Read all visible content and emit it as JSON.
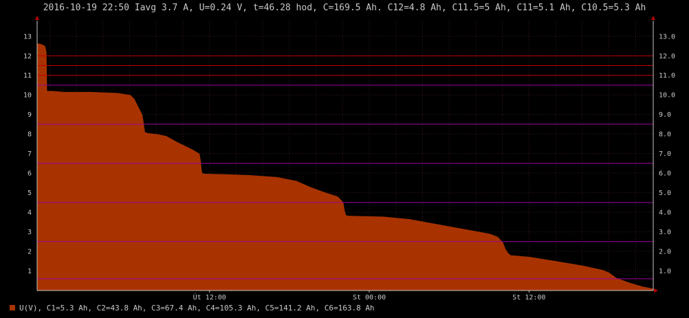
{
  "header": {
    "title": "2016-10-19 22:50 Iavg 3.7 A, U=0.24 V, t=46.28 hod, C=169.5 Ah. C12=4.8 Ah, C11.5=5 Ah, C11=5.1 Ah, C10.5=5.3 Ah"
  },
  "colors": {
    "background": "#000000",
    "area": "#a83300",
    "grid": "#3a1a1a",
    "axis": "#c8c8c8",
    "red_line": "#c00000",
    "purple_line": "#a000a0",
    "text": "#c8c8c8"
  },
  "legend": {
    "swatch_color": "#a83300",
    "text": "U(V), C1=5.3 Ah, C2=43.8 Ah, C3=67.4 Ah, C4=105.3 Ah, C5=141.2 Ah, C6=163.8 Ah"
  },
  "chart_data": {
    "type": "area",
    "title": "2016-10-19 22:50 Iavg 3.7 A, U=0.24 V, t=46.28 hod, C=169.5 Ah. C12=4.8 Ah, C11.5=5 Ah, C11=5.1 Ah, C10.5=5.3 Ah",
    "xlabel": "",
    "ylabel": "",
    "xlim": [
      0,
      46.28
    ],
    "ylim": [
      0,
      13.8
    ],
    "grid": true,
    "legend_position": "bottom-left",
    "x_ticks": [
      {
        "x": 12.95,
        "label": "Út 12:00"
      },
      {
        "x": 24.95,
        "label": "St 00:00"
      },
      {
        "x": 36.95,
        "label": "St 12:00"
      }
    ],
    "y_ticks_left": [
      {
        "y": 1,
        "label": "1"
      },
      {
        "y": 2,
        "label": "2"
      },
      {
        "y": 3,
        "label": "3"
      },
      {
        "y": 4,
        "label": "4"
      },
      {
        "y": 5,
        "label": "5"
      },
      {
        "y": 6,
        "label": "6"
      },
      {
        "y": 7,
        "label": "7"
      },
      {
        "y": 8,
        "label": "8"
      },
      {
        "y": 9,
        "label": "9"
      },
      {
        "y": 10,
        "label": "10"
      },
      {
        "y": 11,
        "label": "11"
      },
      {
        "y": 12,
        "label": "12"
      },
      {
        "y": 13,
        "label": "13"
      }
    ],
    "y_ticks_right": [
      {
        "y": 1,
        "label": "1.0"
      },
      {
        "y": 2,
        "label": "2.0"
      },
      {
        "y": 3,
        "label": "3.0"
      },
      {
        "y": 4,
        "label": "4.0"
      },
      {
        "y": 5,
        "label": "5.0"
      },
      {
        "y": 6,
        "label": "6.0"
      },
      {
        "y": 7,
        "label": "7.0"
      },
      {
        "y": 8,
        "label": "8.0"
      },
      {
        "y": 9,
        "label": "9.0"
      },
      {
        "y": 10,
        "label": "10.0"
      },
      {
        "y": 11,
        "label": "11.0"
      },
      {
        "y": 12,
        "label": "12.0"
      },
      {
        "y": 13,
        "label": "13.0"
      }
    ],
    "reference_lines": [
      {
        "y": 12,
        "color": "#c00000"
      },
      {
        "y": 11.5,
        "color": "#c00000"
      },
      {
        "y": 11,
        "color": "#c00000"
      },
      {
        "y": 10.5,
        "color": "#a000a0"
      },
      {
        "y": 8.5,
        "color": "#a000a0"
      },
      {
        "y": 6.5,
        "color": "#a000a0"
      },
      {
        "y": 4.5,
        "color": "#a000a0"
      },
      {
        "y": 2.5,
        "color": "#a000a0"
      },
      {
        "y": 0.6,
        "color": "#a000a0"
      }
    ],
    "series": [
      {
        "name": "U(V)",
        "color": "#a83300",
        "x": [
          0,
          0.3,
          0.6,
          0.7,
          0.75,
          1.2,
          2.0,
          4.0,
          6.0,
          7.0,
          7.3,
          7.6,
          7.9,
          8.0,
          8.1,
          8.3,
          9.0,
          9.7,
          10.5,
          11.7,
          12.2,
          12.3,
          12.35,
          12.4,
          12.6,
          14.0,
          16.0,
          18.0,
          19.5,
          20.5,
          21.5,
          22.6,
          23.0,
          23.1,
          23.2,
          23.4,
          26.0,
          28.0,
          30.0,
          32.0,
          34.0,
          34.6,
          35.0,
          35.2,
          35.4,
          35.6,
          36.0,
          37.0,
          39.0,
          41.0,
          42.5,
          43.0,
          43.5,
          44.5,
          45.5,
          46.28
        ],
        "y": [
          12.65,
          12.6,
          12.5,
          12.2,
          10.2,
          10.2,
          10.15,
          10.15,
          10.1,
          10.0,
          9.8,
          9.4,
          9.0,
          8.6,
          8.1,
          8.05,
          8.0,
          7.9,
          7.6,
          7.2,
          7.0,
          6.6,
          6.2,
          6.0,
          5.97,
          5.95,
          5.9,
          5.8,
          5.6,
          5.3,
          5.05,
          4.8,
          4.5,
          4.1,
          3.85,
          3.82,
          3.78,
          3.65,
          3.4,
          3.15,
          2.9,
          2.75,
          2.45,
          2.1,
          1.9,
          1.8,
          1.78,
          1.72,
          1.5,
          1.27,
          1.05,
          0.9,
          0.65,
          0.4,
          0.2,
          0.1
        ]
      }
    ]
  }
}
